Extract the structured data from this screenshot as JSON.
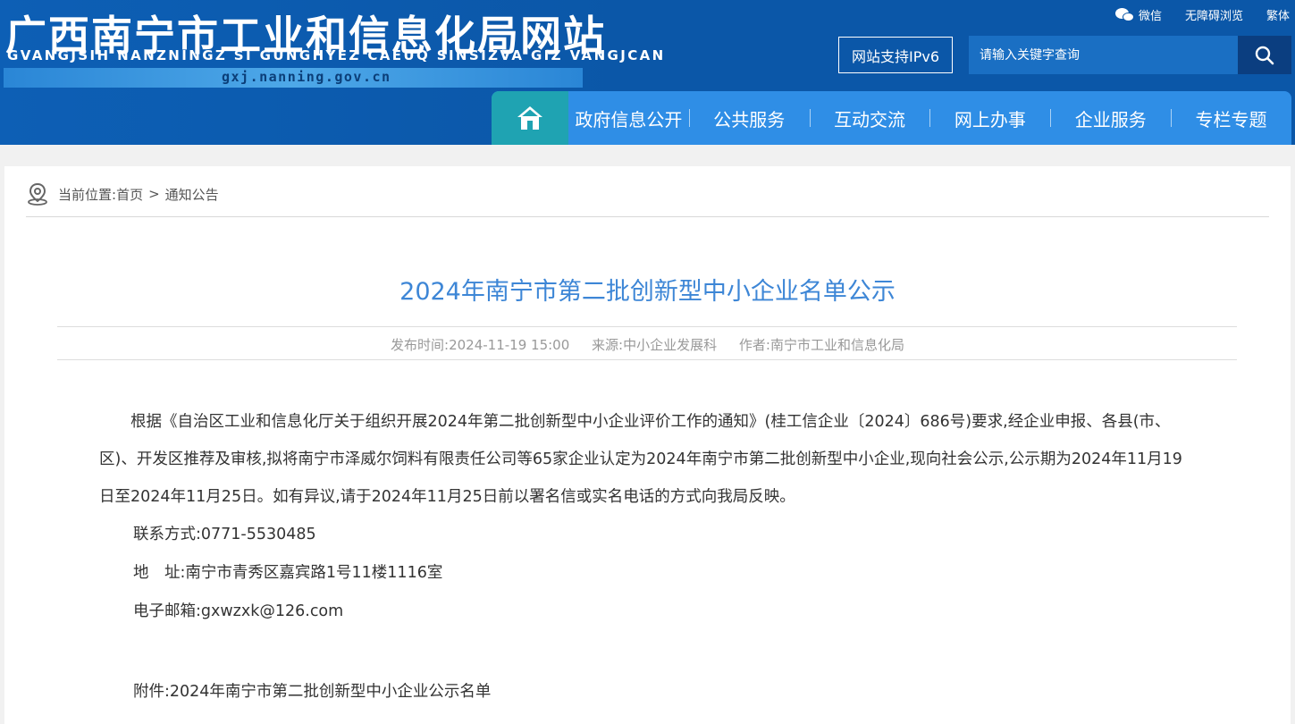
{
  "header": {
    "title": "广西南宁市工业和信息化局网站",
    "subtitle": "GVANGJSIH NANZNINGZ SI GUNGHYEZ CAEUQ SINSIZVA GIZ VANGJCAN",
    "domain": "gxj.nanning.gov.cn",
    "wechat_label": "微信",
    "accessibility_label": "无障碍浏览",
    "traditional_label": "繁体",
    "ipv6_label": "网站支持IPv6",
    "search_placeholder": "请输入关键字查询"
  },
  "nav": {
    "items": [
      "政府信息公开",
      "公共服务",
      "互动交流",
      "网上办事",
      "企业服务",
      "专栏专题"
    ]
  },
  "breadcrumb": {
    "label": "当前位置:",
    "home": "首页",
    "separator": ">",
    "current": "通知公告"
  },
  "article": {
    "title": "2024年南宁市第二批创新型中小企业名单公示",
    "publish_time": "发布时间:2024-11-19 15:00",
    "source": "来源:中小企业发展科",
    "author": "作者:南宁市工业和信息化局",
    "paragraph": "根据《自治区工业和信息化厅关于组织开展2024年第二批创新型中小企业评价工作的通知》(桂工信企业〔2024〕686号)要求,经企业申报、各县(市、区)、开发区推荐及审核,拟将南宁市泽威尔饲料有限责任公司等65家企业认定为2024年南宁市第二批创新型中小企业,现向社会公示,公示期为2024年11月19日至2024年11月25日。如有异议,请于2024年11月25日前以署名信或实名电话的方式向我局反映。",
    "contact": "联系方式:0771-5530485",
    "address": "地　址:南宁市青秀区嘉宾路1号11楼1116室",
    "email": "电子邮箱:gxwzxk@126.com",
    "attachment": "附件:2024年南宁市第二批创新型中小企业公示名单"
  },
  "colors": {
    "header_bg": "#0b57a8",
    "nav_bg": "#2f8ee6",
    "nav_home_bg": "#1fa3b2",
    "title_color": "#3d86d6"
  }
}
